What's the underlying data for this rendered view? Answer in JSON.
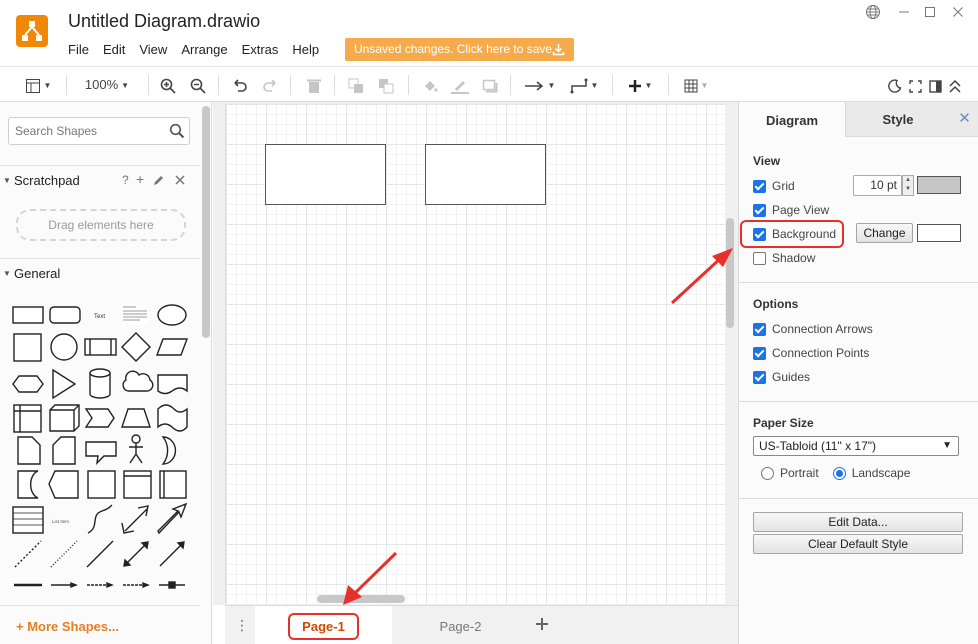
{
  "app": {
    "title": "Untitled Diagram.drawio",
    "logo": "drawio-logo",
    "accent": "#f08705"
  },
  "menu": [
    "File",
    "Edit",
    "View",
    "Arrange",
    "Extras",
    "Help"
  ],
  "unsaved_banner": "Unsaved changes. Click here to save.",
  "toolbar": {
    "zoom": "100%"
  },
  "left": {
    "search_placeholder": "Search Shapes",
    "scratchpad": "Scratchpad",
    "scratchpad_actions": [
      "?",
      "+"
    ],
    "drag_hint": "Drag elements here",
    "general": "General",
    "more_shapes": "+ More Shapes..."
  },
  "pages": {
    "tabs": [
      "Page-1",
      "Page-2"
    ],
    "active": "Page-1"
  },
  "right": {
    "tabs": {
      "diagram": "Diagram",
      "style": "Style"
    },
    "view": {
      "title": "View",
      "grid": "Grid",
      "grid_size": "10 pt",
      "page_view": "Page View",
      "background": "Background",
      "change": "Change",
      "shadow": "Shadow"
    },
    "options": {
      "title": "Options",
      "connection_arrows": "Connection Arrows",
      "connection_points": "Connection Points",
      "guides": "Guides"
    },
    "paper": {
      "title": "Paper Size",
      "selected": "US-Tabloid (11\" x 17\")",
      "portrait": "Portrait",
      "landscape": "Landscape"
    },
    "edit_data": "Edit Data...",
    "clear_style": "Clear Default Style"
  },
  "colors": {
    "checkbox": "#1a73e8",
    "highlight": "#e8302a",
    "unsaved_bg": "#f5ab4c"
  }
}
